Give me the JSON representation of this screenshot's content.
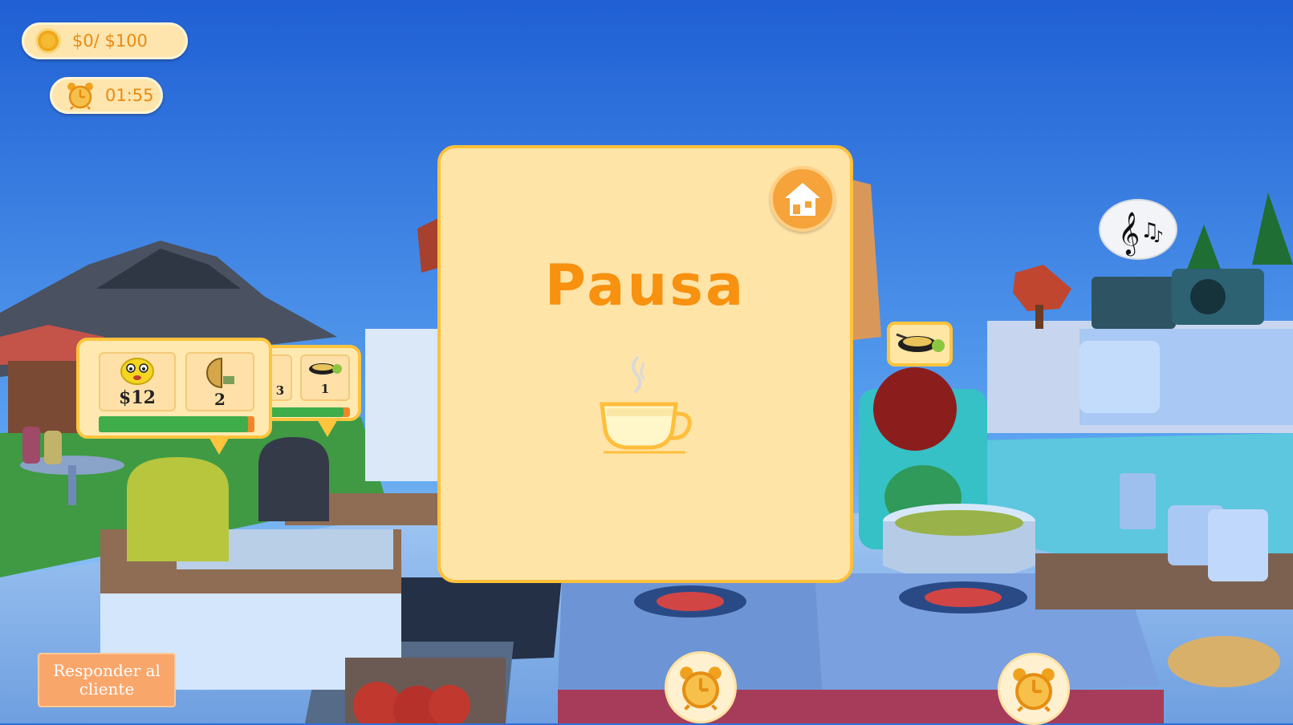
{
  "hud": {
    "money": "$0/ $100",
    "timer": "01:55"
  },
  "orders": [
    {
      "price": "$12",
      "count": "2",
      "progress": 0.96
    },
    {
      "partial_count": "3",
      "count": "1",
      "progress": 0.92
    }
  ],
  "pause_menu": {
    "title": "Pausa",
    "home_icon": "home-icon",
    "illustration": "steaming-tea-cup-icon"
  },
  "actions": {
    "respond_label_line1": "Responder al",
    "respond_label_line2": "cliente"
  },
  "icons": {
    "coin": "coin-icon",
    "alarm": "alarm-clock-icon",
    "music": "music-notes-icon",
    "dish": "frying-pan-dish-icon"
  },
  "colors": {
    "accent_orange": "#f7910f",
    "panel": "#ffe4a8",
    "panel_border": "#ffc13a",
    "progress_green": "#3fae4a",
    "sky": "#2f6fd8"
  }
}
